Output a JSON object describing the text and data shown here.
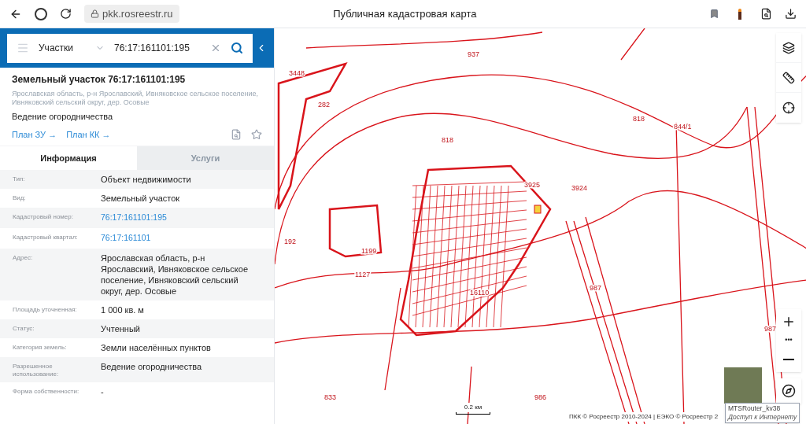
{
  "browser": {
    "url": "pkk.rosreestr.ru",
    "title": "Публичная кадастровая карта"
  },
  "search": {
    "category": "Участки",
    "value": "76:17:161101:195"
  },
  "parcel": {
    "title": "Земельный участок 76:17:161101:195",
    "address": "Ярославская область, р-н Ярославский, Ивняковское сельское поселение, Ивняковский сельский округ, дер. Осовые",
    "usage": "Ведение огородничества",
    "links": [
      "План ЗУ →",
      "План КК →"
    ]
  },
  "tabs": [
    {
      "label": "Информация",
      "selected": true
    },
    {
      "label": "Услуги",
      "selected": false
    }
  ],
  "rows": [
    {
      "label": "Тип:",
      "value": "Объект недвижимости",
      "kind": "text"
    },
    {
      "label": "Вид:",
      "value": "Земельный участок",
      "kind": "text"
    },
    {
      "label": "Кадастровый номер:",
      "value": "76:17:161101:195",
      "kind": "link"
    },
    {
      "label": "Кадастровый квартал:",
      "value": "76:17:161101",
      "kind": "link"
    },
    {
      "label": "Адрес:",
      "value": "Ярославская область, р-н Ярославский, Ивняковское сельское поселение, Ивняковский сельский округ, дер. Осовые",
      "kind": "text"
    },
    {
      "label": "Площадь уточненная:",
      "value": "1 000 кв. м",
      "kind": "text"
    },
    {
      "label": "Статус:",
      "value": "Учтенный",
      "kind": "text"
    },
    {
      "label": "Категория земель:",
      "value": "Земли населённых пунктов",
      "kind": "text"
    },
    {
      "label": "Разрешенное использование:",
      "value": "Ведение огородничества",
      "kind": "text"
    },
    {
      "label": "Форма собственности:",
      "value": "-",
      "kind": "text"
    }
  ],
  "map": {
    "labels": [
      "3448",
      "937",
      "282",
      "818",
      "818",
      "844/1",
      "3925",
      "3924",
      "192",
      "1199",
      "1127",
      "16110",
      "987",
      "987",
      "833",
      "986"
    ],
    "zoom_more": "•••",
    "scale": "0.2 км",
    "attribution": "ПКК © Росреестр 2010-2024 | ЕЭКО © Росреестр 2"
  },
  "tooltip": {
    "title": "MTSRouter_kv38",
    "subtitle": "Доступ к Интернету"
  }
}
